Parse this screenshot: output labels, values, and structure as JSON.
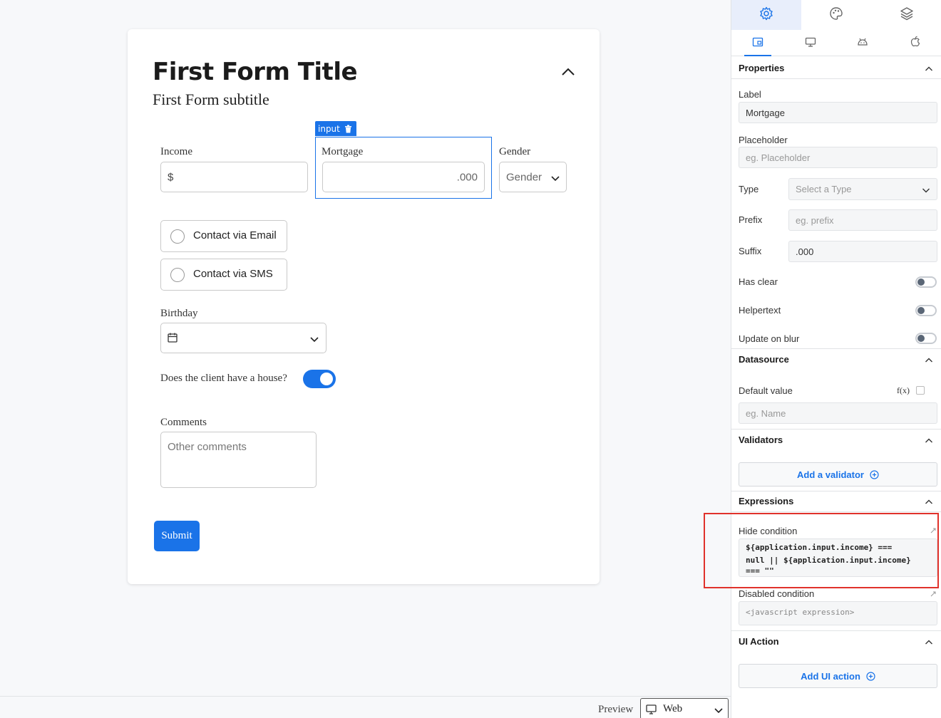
{
  "form": {
    "title": "First Form Title",
    "subtitle": "First Form subtitle",
    "selected_tag": "input",
    "fields": {
      "income_label": "Income",
      "income_prefix": "$",
      "mortgage_label": "Mortgage",
      "mortgage_suffix": ".000",
      "gender_label": "Gender",
      "gender_value": "Gender",
      "contact_email": "Contact via Email",
      "contact_sms": "Contact via SMS",
      "birthday_label": "Birthday",
      "house_label": "Does the client have a house?",
      "house_toggle_on": true,
      "comments_label": "Comments",
      "comments_placeholder": "Other comments"
    },
    "submit_label": "Submit"
  },
  "preview": {
    "label": "Preview",
    "selected": "Web"
  },
  "panel": {
    "top_tabs": [
      "gear-icon",
      "palette-icon",
      "layers-icon"
    ],
    "sub_tabs": [
      "layout-icon",
      "monitor-icon",
      "android-icon",
      "apple-icon"
    ],
    "properties": {
      "title": "Properties",
      "label_label": "Label",
      "label_value": "Mortgage",
      "placeholder_label": "Placeholder",
      "placeholder_placeholder": "eg. Placeholder",
      "type_label": "Type",
      "type_placeholder": "Select a Type",
      "prefix_label": "Prefix",
      "prefix_placeholder": "eg. prefix",
      "suffix_label": "Suffix",
      "suffix_value": ".000",
      "has_clear_label": "Has clear",
      "helpertext_label": "Helpertext",
      "update_on_blur_label": "Update on blur"
    },
    "datasource": {
      "title": "Datasource",
      "default_value_label": "Default value",
      "fx_label": "f(x)",
      "default_value_placeholder": "eg. Name"
    },
    "validators": {
      "title": "Validators",
      "add_label": "Add a validator"
    },
    "expressions": {
      "title": "Expressions",
      "hide_condition_label": "Hide condition",
      "hide_condition_line1": "${application.input.income} ===",
      "hide_condition_line2": "null || ${application.input.income}",
      "hide_condition_line3": "=== \"\"",
      "disabled_condition_label": "Disabled condition",
      "disabled_condition_placeholder": "<javascript expression>"
    },
    "ui_action": {
      "title": "UI Action",
      "add_label": "Add UI action"
    }
  },
  "colors": {
    "accent": "#1a73e8",
    "highlight": "#e0322b"
  }
}
